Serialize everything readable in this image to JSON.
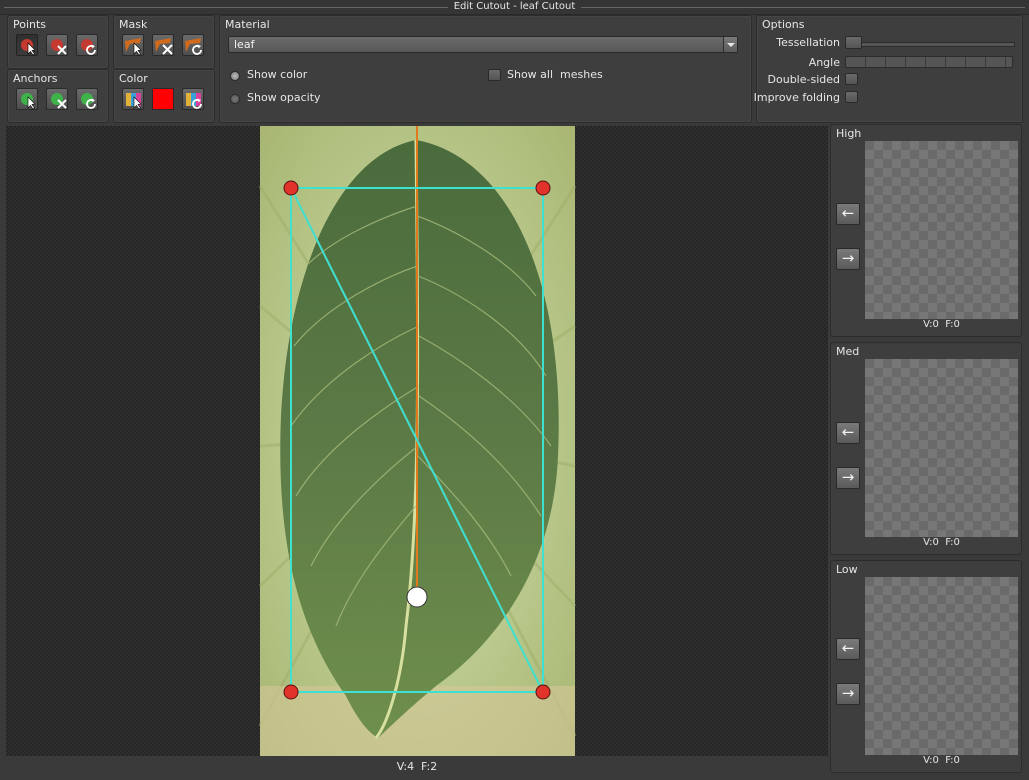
{
  "window": {
    "title": "Edit Cutout - leaf Cutout"
  },
  "points": {
    "label": "Points",
    "buttons": [
      "select-point-icon",
      "delete-point-icon",
      "reset-point-icon"
    ]
  },
  "anchors": {
    "label": "Anchors",
    "buttons": [
      "select-anchor-icon",
      "delete-anchor-icon",
      "reset-anchor-icon"
    ]
  },
  "mask": {
    "label": "Mask",
    "buttons": [
      "select-mask-icon",
      "delete-mask-icon",
      "reset-mask-icon"
    ]
  },
  "color": {
    "label": "Color",
    "swatch": "#ff0000",
    "buttons": [
      "pick-color-icon",
      "color-swatch",
      "reset-color-icon"
    ]
  },
  "material": {
    "label": "Material",
    "selected": "leaf",
    "show_color": "Show color",
    "show_opacity": "Show opacity",
    "show_all_meshes": "Show all  meshes",
    "show_color_checked": true,
    "show_all_meshes_checked": false
  },
  "options": {
    "label": "Options",
    "tessellation": "Tessellation",
    "angle": "Angle",
    "double_sided": "Double-sided",
    "improve_folding": "Improve folding",
    "double_sided_checked": false,
    "improve_folding_checked": false
  },
  "viewport": {
    "status": "V:4  F:2",
    "outline_color": "#3ee0d0",
    "point_color": "#e0332a",
    "anchor_color": "#ffffff",
    "stem_color": "#e07a1a"
  },
  "lod": [
    {
      "label": "High",
      "count": "V:0  F:0"
    },
    {
      "label": "Med",
      "count": "V:0  F:0"
    },
    {
      "label": "Low",
      "count": "V:0  F:0"
    }
  ]
}
